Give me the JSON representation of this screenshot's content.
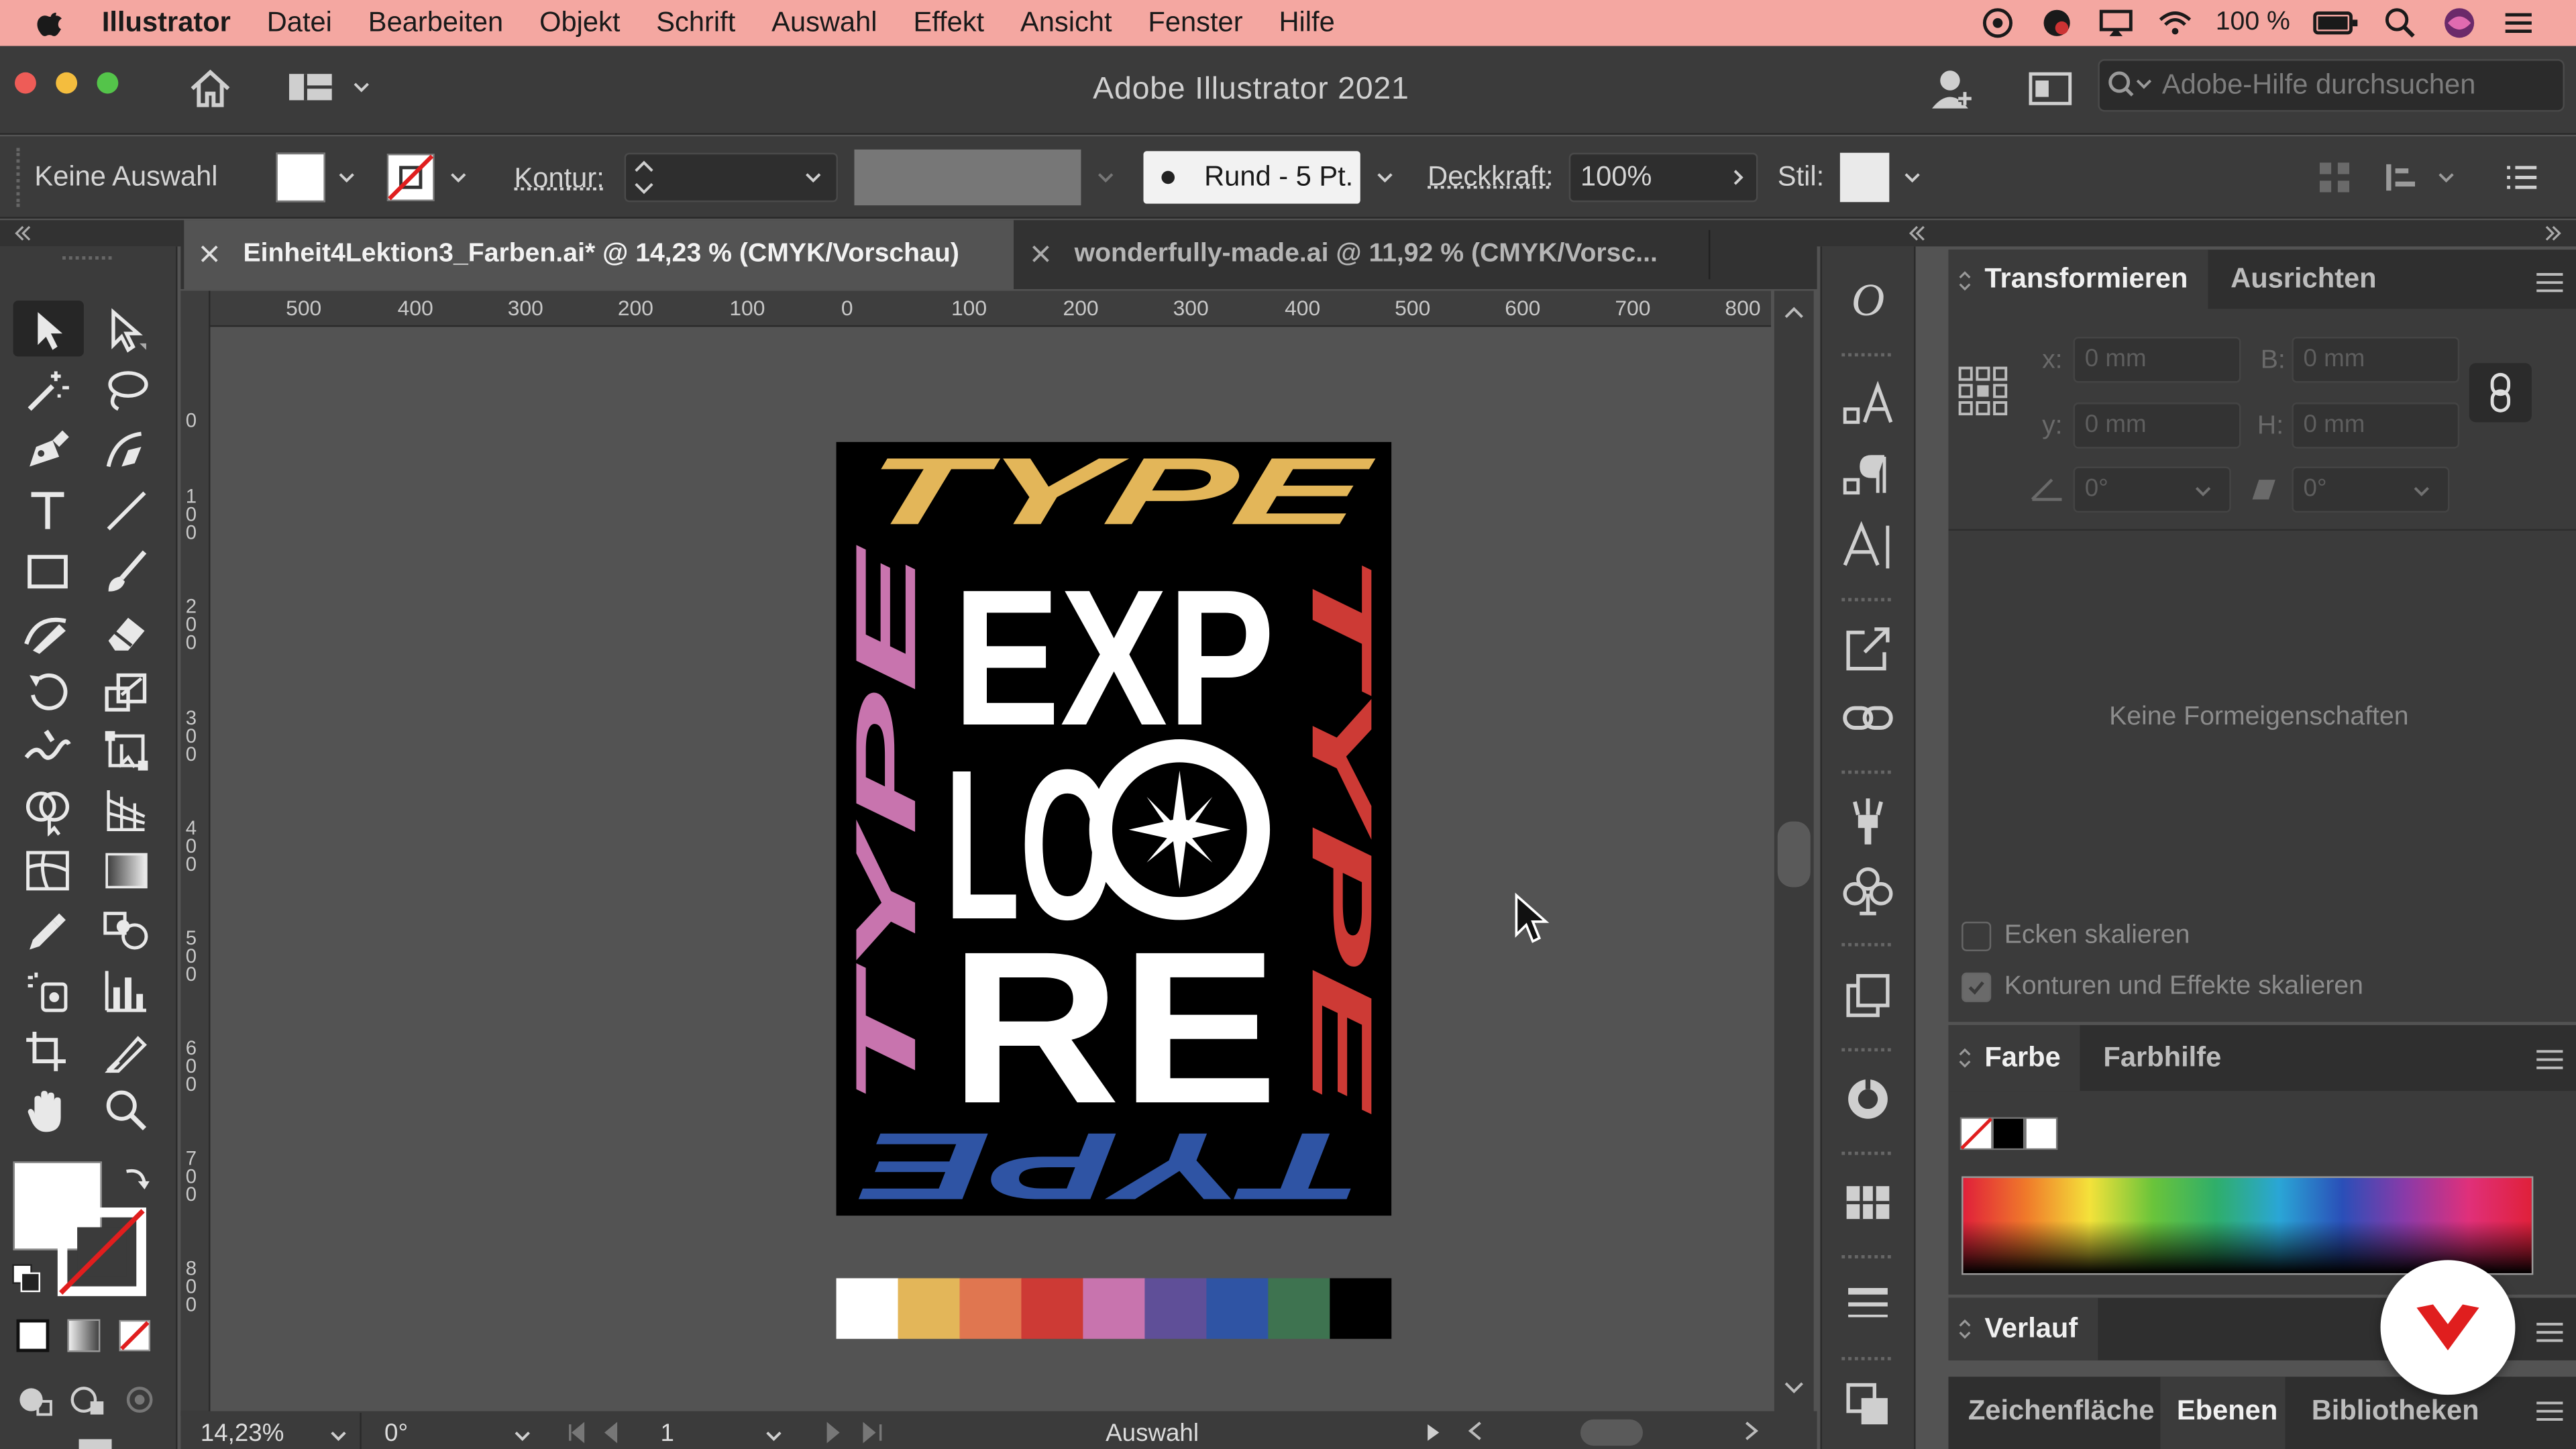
{
  "menu": {
    "app": "Illustrator",
    "items": [
      "Datei",
      "Bearbeiten",
      "Objekt",
      "Schrift",
      "Auswahl",
      "Effekt",
      "Ansicht",
      "Fenster",
      "Hilfe"
    ],
    "battery": "100 %"
  },
  "window": {
    "title": "Adobe Illustrator 2021",
    "search_placeholder": "Adobe-Hilfe durchsuchen"
  },
  "control": {
    "selection": "Keine Auswahl",
    "stroke_label": "Kontur:",
    "brush": "Rund - 5 Pt.",
    "opacity_label": "Deckkraft:",
    "opacity_value": "100%",
    "style_label": "Stil:"
  },
  "tabs": [
    {
      "label": "Einheit4Lektion3_Farben.ai* @ 14,23 % (CMYK/Vorschau)",
      "active": true
    },
    {
      "label": "wonderfully-made.ai @ 11,92 % (CMYK/Vorsc...",
      "active": false
    }
  ],
  "ruler_h": [
    "500",
    "400",
    "300",
    "200",
    "100",
    "0",
    "100",
    "200",
    "300",
    "400",
    "500",
    "600",
    "700",
    "800"
  ],
  "ruler_v": [
    "0",
    "100",
    "200",
    "300",
    "400",
    "500",
    "600",
    "700",
    "800"
  ],
  "artwork": {
    "word_type": "TYPE",
    "explore_1": "EXP",
    "explore_2": "LO",
    "explore_3": "RE"
  },
  "swatches": [
    "#ffffff",
    "#e3b659",
    "#e07650",
    "#cd3a35",
    "#c874ae",
    "#5f4f98",
    "#2f54a4",
    "#3e7350",
    "#000000"
  ],
  "status": {
    "zoom": "14,23%",
    "rotation": "0°",
    "artboard": "1",
    "mode": "Auswahl"
  },
  "panels": {
    "transform": {
      "tab_active": "Transformieren",
      "tab_other": "Ausrichten",
      "x_label": "x:",
      "x_value": "0 mm",
      "y_label": "y:",
      "y_value": "0 mm",
      "w_label": "B:",
      "w_value": "0 mm",
      "h_label": "H:",
      "h_value": "0 mm",
      "angle_value": "0°",
      "shear_value": "0°",
      "no_props": "Keine Formeigenschaften",
      "scale_corners": "Ecken skalieren",
      "scale_strokes": "Konturen und Effekte skalieren"
    },
    "color": {
      "tab_active": "Farbe",
      "tab_other": "Farbhilfe"
    },
    "gradient": {
      "tab_active": "Verlauf"
    },
    "bottom": {
      "tabs": [
        "Zeichenflächen",
        "Ebenen",
        "Bibliotheken"
      ],
      "active_index": 1
    }
  },
  "colors": {
    "menubar": "#f4a7a1",
    "panel": "#3b3b3b",
    "canvas": "#535353",
    "accent_red": "#e01e1e"
  }
}
